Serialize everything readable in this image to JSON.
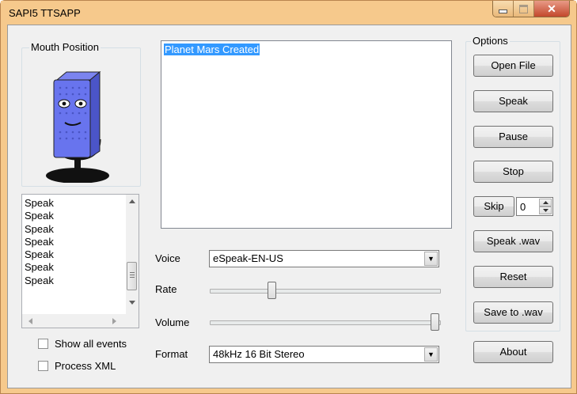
{
  "window": {
    "title": "SAPI5 TTSAPP",
    "close_glyph": "✕"
  },
  "mouth_panel": {
    "label": "Mouth Position"
  },
  "events_list": {
    "items": [
      "Speak",
      "Speak",
      "Speak",
      "Speak",
      "Speak",
      "Speak",
      "Speak"
    ]
  },
  "checkboxes": {
    "show_all_events": "Show all events",
    "process_xml": "Process XML"
  },
  "text_area": {
    "value": "Planet Mars Created"
  },
  "voice": {
    "label": "Voice",
    "value": "eSpeak-EN-US"
  },
  "rate": {
    "label": "Rate",
    "level": 0.26
  },
  "volume": {
    "label": "Volume",
    "level": 1.0
  },
  "format": {
    "label": "Format",
    "value": "48kHz 16 Bit Stereo"
  },
  "options": {
    "label": "Options",
    "open_file": "Open File",
    "speak": "Speak",
    "pause": "Pause",
    "stop": "Stop",
    "skip": "Skip",
    "skip_value": "0",
    "speak_wav": "Speak .wav",
    "reset": "Reset",
    "save_wav": "Save to .wav"
  },
  "about": "About"
}
